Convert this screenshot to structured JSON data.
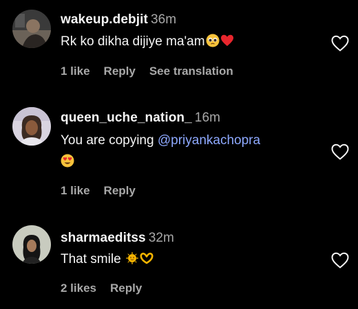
{
  "comments": [
    {
      "username": "wakeup.debjit",
      "time": "36m",
      "text": "Rk ko dikha dijiye ma'am",
      "emojis": [
        "pleading-face",
        "red-heart"
      ],
      "likes": "1 like",
      "reply": "Reply",
      "translate": "See translation"
    },
    {
      "username": "queen_uche_nation_",
      "time": "16m",
      "text": "You are copying ",
      "mention": "@priyankachopra",
      "emojis": [
        "heart-eyes-face"
      ],
      "likes": "1 like",
      "reply": "Reply"
    },
    {
      "username": "sharmaeditss",
      "time": "32m",
      "text": "That smile ",
      "emojis": [
        "sun-with-face",
        "heart-hands"
      ],
      "likes": "2 likes",
      "reply": "Reply"
    }
  ],
  "colors": {
    "background": "#000000",
    "text": "#f5f5f5",
    "secondary": "#a8a8a8",
    "mention": "#8ea9ff"
  }
}
